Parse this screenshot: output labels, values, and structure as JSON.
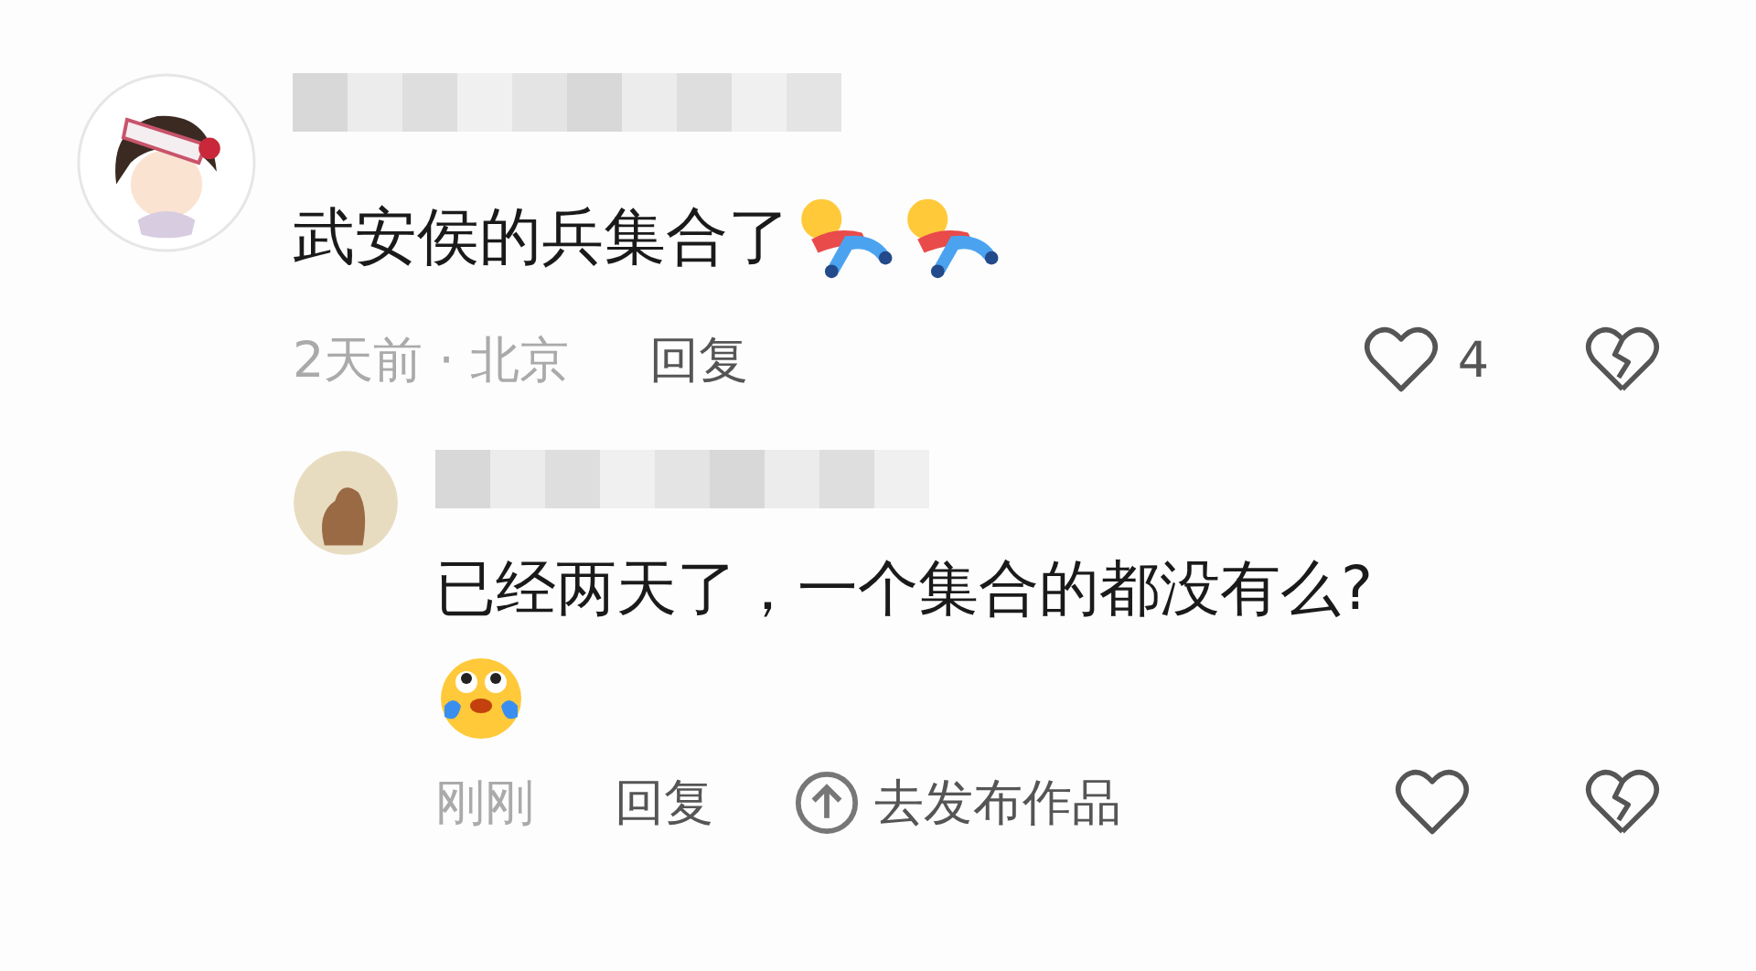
{
  "comments": [
    {
      "avatar": {
        "kind": "girl"
      },
      "content": [
        {
          "kind": "text",
          "text": "武安侯的兵集合了"
        },
        {
          "kind": "lying-figure"
        },
        {
          "kind": "lying-figure"
        }
      ],
      "meta": {
        "time": "2天前 · 北京",
        "reply": "回复",
        "likes": "4"
      },
      "replies": [
        {
          "avatar": {
            "kind": "animal"
          },
          "content": [
            {
              "kind": "text",
              "text": "已经两天了，一个集合的都没有么?"
            },
            {
              "kind": "break"
            },
            {
              "kind": "crying-face"
            }
          ],
          "meta": {
            "time": "刚刚",
            "reply": "回复",
            "publish": "去发布作品"
          }
        }
      ]
    }
  ]
}
